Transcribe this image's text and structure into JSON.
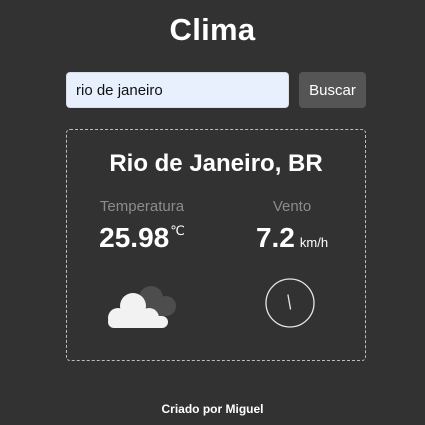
{
  "app": {
    "title": "Clima"
  },
  "search": {
    "value": "rio de janeiro",
    "button_label": "Buscar"
  },
  "weather": {
    "city": "Rio de Janeiro, BR",
    "temperature": {
      "label": "Temperatura",
      "value": "25.98",
      "unit": "℃"
    },
    "wind": {
      "label": "Vento",
      "value": "7.2",
      "unit": "km/h",
      "icon": "compass-icon"
    },
    "condition_icon": "cloud-icon"
  },
  "footer": {
    "text": "Criado por Miguel"
  }
}
